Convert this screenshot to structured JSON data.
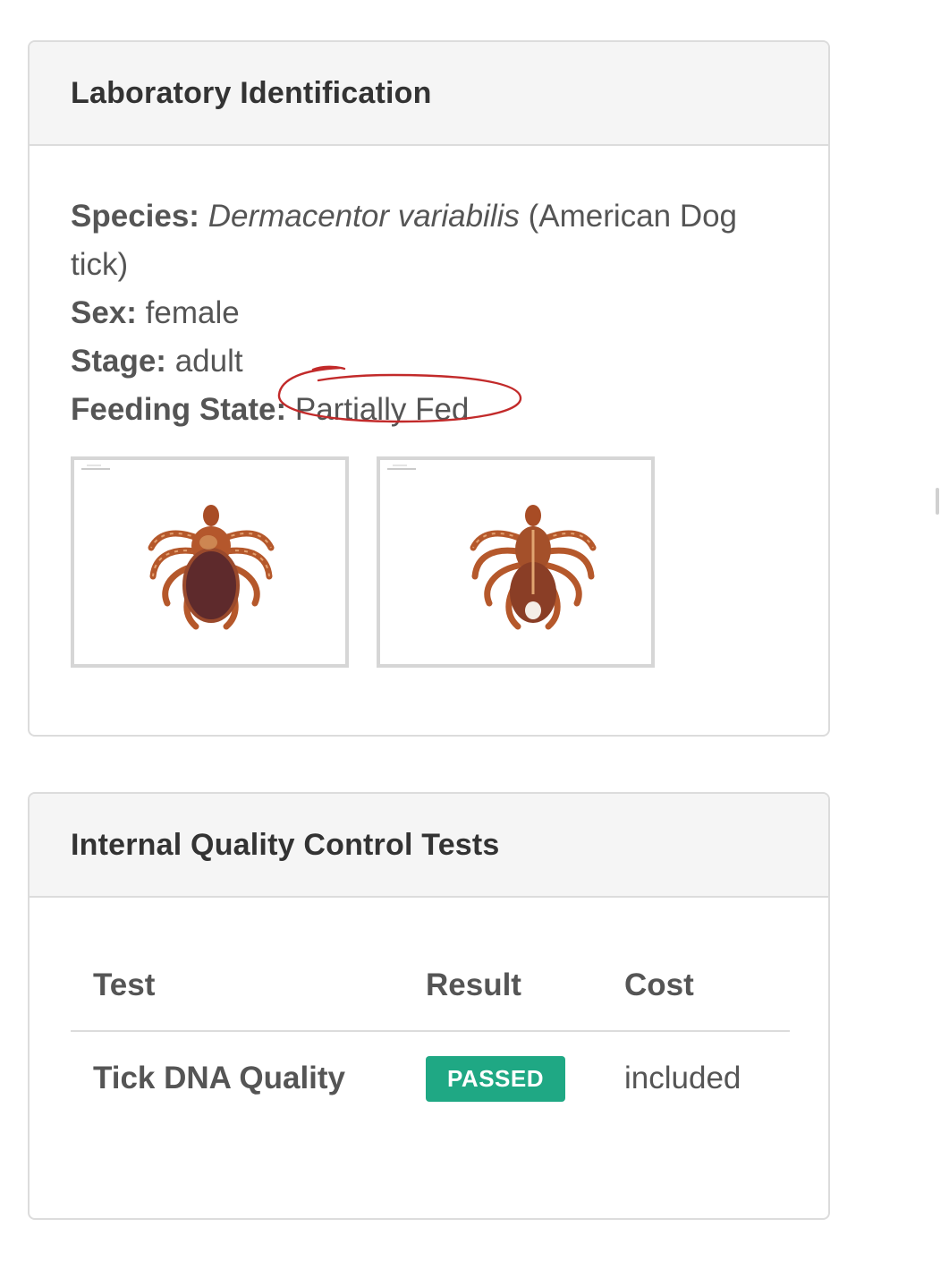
{
  "lab_identification": {
    "title": "Laboratory Identification",
    "species_label": "Species:",
    "species_scientific": "Dermacentor variabilis",
    "species_common": "(American Dog tick)",
    "sex_label": "Sex:",
    "sex_value": "female",
    "stage_label": "Stage:",
    "stage_value": "adult",
    "feeding_label": "Feeding State:",
    "feeding_value": "Partially Fed",
    "annotation_color": "#c22a2a",
    "photos": [
      {
        "view": "dorsal"
      },
      {
        "view": "ventral"
      }
    ]
  },
  "quality_control": {
    "title": "Internal Quality Control Tests",
    "columns": [
      "Test",
      "Result",
      "Cost"
    ],
    "rows": [
      {
        "test": "Tick DNA Quality",
        "result": "PASSED",
        "cost": "included"
      }
    ],
    "badge_color": "#1fa884"
  }
}
